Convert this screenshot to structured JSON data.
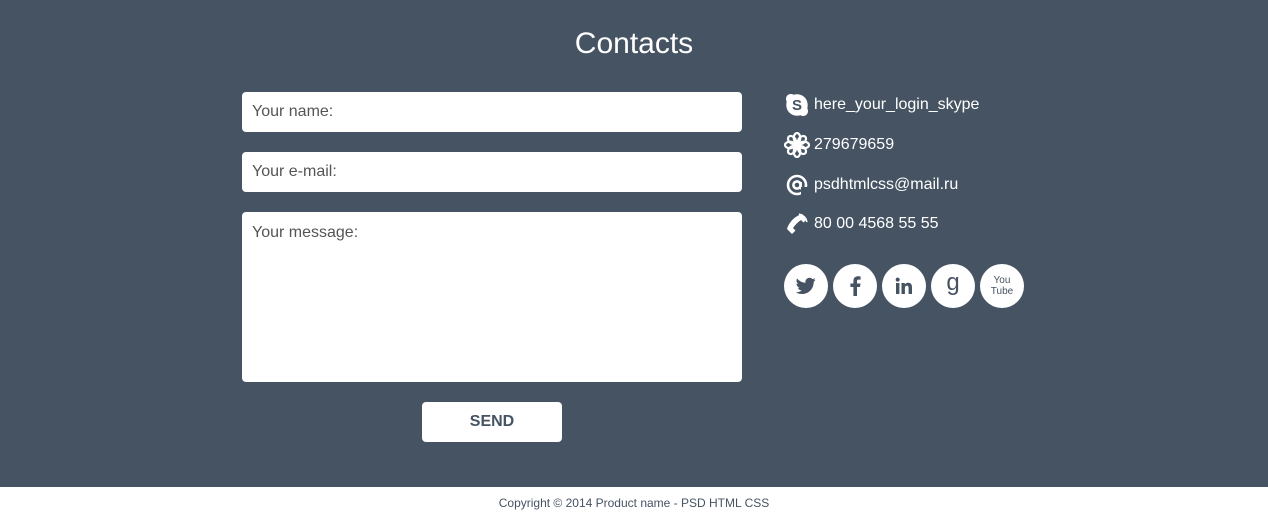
{
  "section": {
    "title": "Contacts"
  },
  "form": {
    "name_placeholder": "Your name:",
    "email_placeholder": "Your e-mail:",
    "message_placeholder": "Your message:",
    "send_label": "SEND"
  },
  "contacts": {
    "skype": "here_your_login_skype",
    "icq": "279679659",
    "email": "psdhtmlcss@mail.ru",
    "phone": "80 00 4568 55 55"
  },
  "social": {
    "youtube_line1": "You",
    "youtube_line2": "Tube",
    "google_glyph": "g"
  },
  "footer": {
    "copyright": "Copyright © 2014 Product name - PSD HTML CSS"
  },
  "colors": {
    "background": "#465363",
    "text_light": "#ffffff",
    "footer_bg": "#ffffff"
  },
  "icons": [
    "skype-icon",
    "icq-flower-icon",
    "at-sign-icon",
    "phone-icon",
    "twitter-icon",
    "facebook-icon",
    "linkedin-icon",
    "google-icon",
    "youtube-icon"
  ]
}
